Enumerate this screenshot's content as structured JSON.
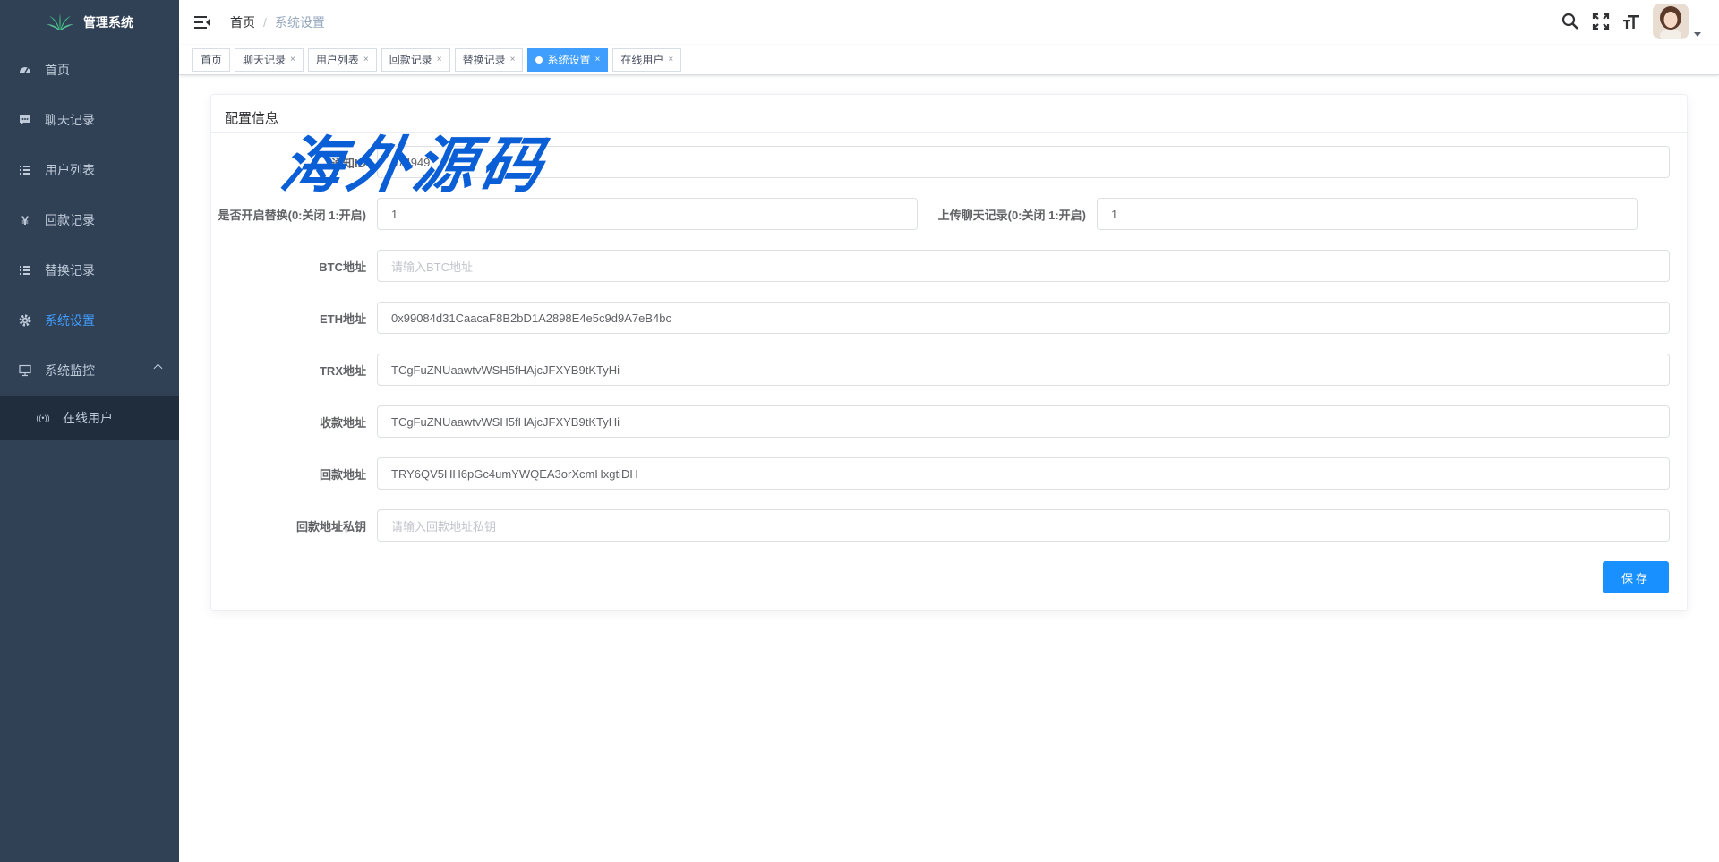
{
  "app": {
    "title": "管理系统"
  },
  "sidebar": {
    "items": [
      {
        "label": "首页",
        "icon": "dashboard-icon",
        "active": false
      },
      {
        "label": "聊天记录",
        "icon": "chat-icon",
        "active": false
      },
      {
        "label": "用户列表",
        "icon": "list-icon",
        "active": false
      },
      {
        "label": "回款记录",
        "icon": "yen-icon",
        "active": false
      },
      {
        "label": "替换记录",
        "icon": "list-icon",
        "active": false
      },
      {
        "label": "系统设置",
        "icon": "gear-icon",
        "active": true
      },
      {
        "label": "系统监控",
        "icon": "monitor-icon",
        "active": false,
        "expanded": true
      }
    ],
    "sub_items": [
      {
        "label": "在线用户",
        "icon": "online-icon"
      }
    ]
  },
  "breadcrumb": {
    "home": "首页",
    "separator": "/",
    "current": "系统设置"
  },
  "tags": [
    {
      "label": "首页",
      "closable": false,
      "active": false
    },
    {
      "label": "聊天记录",
      "closable": true,
      "active": false
    },
    {
      "label": "用户列表",
      "closable": true,
      "active": false
    },
    {
      "label": "回款记录",
      "closable": true,
      "active": false
    },
    {
      "label": "替换记录",
      "closable": true,
      "active": false
    },
    {
      "label": "系统设置",
      "closable": true,
      "active": true
    },
    {
      "label": "在线用户",
      "closable": true,
      "active": false
    }
  ],
  "tag_close": "×",
  "card": {
    "title": "配置信息"
  },
  "watermark": "海外源码",
  "form": {
    "notify": {
      "label": "通知ID",
      "value": "674949"
    },
    "replace_enabled": {
      "label": "是否开启替换(0:关闭 1:开启)",
      "value": "1"
    },
    "upload_chat": {
      "label": "上传聊天记录(0:关闭 1:开启)",
      "value": "1"
    },
    "btc": {
      "label": "BTC地址",
      "value": "",
      "placeholder": "请输入BTC地址"
    },
    "eth": {
      "label": "ETH地址",
      "value": "0x99084d31CaacaF8B2bD1A2898E4e5c9d9A7eB4bc"
    },
    "trx": {
      "label": "TRX地址",
      "value": "TCgFuZNUaawtvWSH5fHAjcJFXYB9tKTyHi"
    },
    "receive": {
      "label": "收款地址",
      "value": "TCgFuZNUaawtvWSH5fHAjcJFXYB9tKTyHi"
    },
    "refund": {
      "label": "回款地址",
      "value": "TRY6QV5HH6pGc4umYWQEA3orXcmHxgtiDH"
    },
    "refund_key": {
      "label": "回款地址私钥",
      "value": "",
      "placeholder": "请输入回款地址私钥"
    }
  },
  "save_label": "保存",
  "colors": {
    "sidebar_bg": "#304156",
    "accent": "#409eff",
    "save_button": "#1890ff"
  }
}
